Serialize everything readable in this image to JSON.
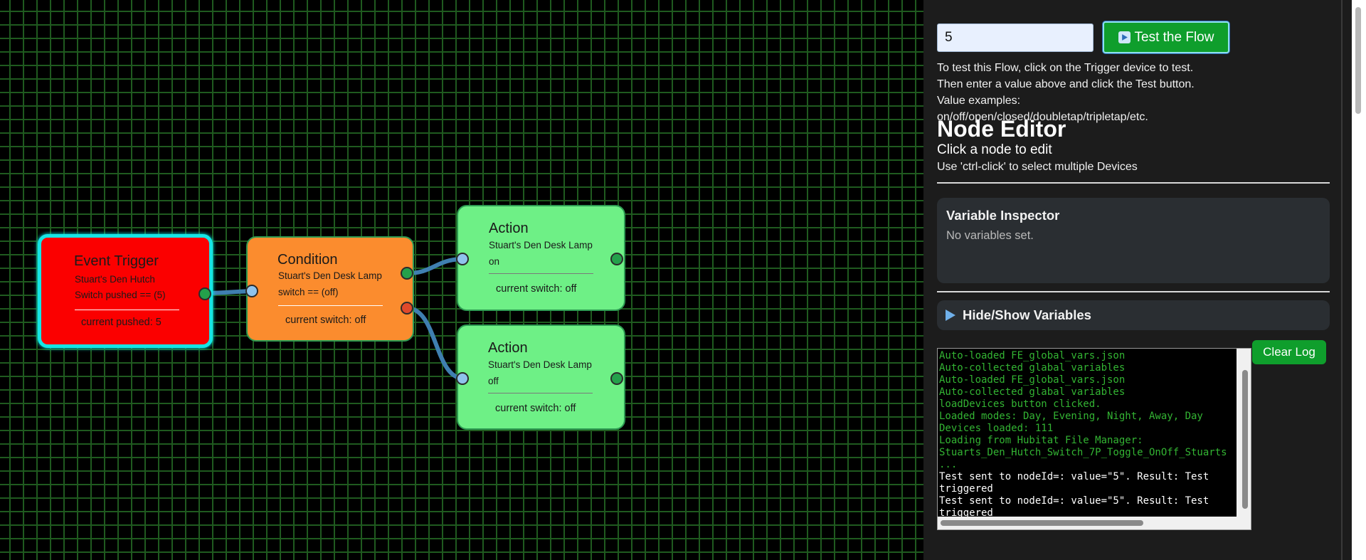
{
  "test": {
    "value": "5",
    "button_label": "Test the Flow",
    "help": "To test this Flow, click on the Trigger device to test. Then enter a value above and click the Test button. Value examples: on/off/open/closed/doubletap/tripletap/etc."
  },
  "editor": {
    "title": "Node Editor",
    "subtitle": "Click a node to edit",
    "hint": "Use 'ctrl-click' to select multiple Devices"
  },
  "variables": {
    "title": "Variable Inspector",
    "empty": "No variables set.",
    "toggle_label": "Hide/Show Variables"
  },
  "log": {
    "clear_label": "Clear Log",
    "lines": [
      {
        "text": "Auto-loaded FE_global_vars.json",
        "color": "green"
      },
      {
        "text": "Auto-collected glabal variables",
        "color": "green"
      },
      {
        "text": "Auto-loaded FE_global_vars.json",
        "color": "green"
      },
      {
        "text": "Auto-collected glabal variables",
        "color": "green"
      },
      {
        "text": "loadDevices button clicked.",
        "color": "green"
      },
      {
        "text": "Loaded modes: Day, Evening, Night, Away, Day",
        "color": "green"
      },
      {
        "text": "Devices loaded: 111",
        "color": "green"
      },
      {
        "text": "Loading from Hubitat File Manager:",
        "color": "green"
      },
      {
        "text": "Stuarts_Den_Hutch_Switch_7P_Toggle_OnOff_Stuarts",
        "color": "green"
      },
      {
        "text": "...",
        "color": "green"
      },
      {
        "text": "Test sent to nodeId=: value=\"5\". Result: Test",
        "color": "white"
      },
      {
        "text": "triggered",
        "color": "white"
      },
      {
        "text": "Test sent to nodeId=: value=\"5\". Result: Test",
        "color": "white"
      },
      {
        "text": "triggered",
        "color": "white"
      }
    ]
  },
  "nodes": {
    "trigger": {
      "title": "Event Trigger",
      "line1": "Stuart's Den Hutch",
      "line2": "Switch pushed == (5)",
      "status": "current pushed: 5"
    },
    "condition": {
      "title": "Condition",
      "line1": "Stuart's Den Desk Lamp",
      "line2": "switch == (off)",
      "status": "current switch: off"
    },
    "action_on": {
      "title": "Action",
      "line1": "Stuart's Den Desk Lamp",
      "line2": "on",
      "status": "current switch: off"
    },
    "action_off": {
      "title": "Action",
      "line1": "Stuart's Den Desk Lamp",
      "line2": "off",
      "status": "current switch: off"
    }
  },
  "colors": {
    "grid": "#1f5a1f",
    "trigger": "#fb0000",
    "trigger_selected_border": "#16e5e5",
    "condition": "#fb8c2e",
    "action": "#6ef086",
    "wire": "#3f7fb0",
    "button_green": "#0f9e2c",
    "log_green": "#33b433"
  }
}
